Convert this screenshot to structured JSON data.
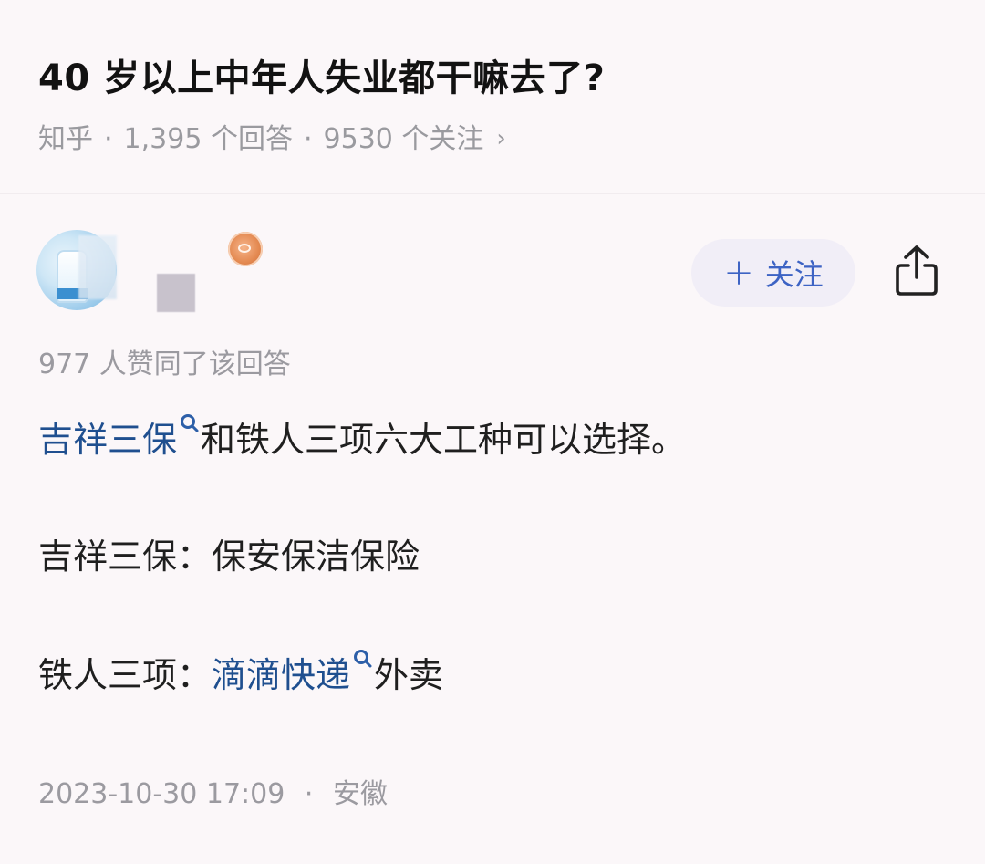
{
  "question": {
    "title": "40 岁以上中年人失业都干嘛去了?",
    "source": "知乎",
    "answers_count": "1,395 个回答",
    "followers_count": "9530 个关注",
    "separator": "·",
    "chevron": "›"
  },
  "author": {
    "follow_label": "关注",
    "follow_plus": "+",
    "avatar_icon": "avatar-image",
    "badge_icon": "medal-badge-icon",
    "share_icon": "share-icon"
  },
  "answer": {
    "vote_text": "977 人赞同了该回答",
    "p1_link": "吉祥三保",
    "p1_rest": "和铁人三项六大工种可以选择。",
    "p2": "吉祥三保：保安保洁保险",
    "p3_prefix": "铁人三项：",
    "p3_link": "滴滴快递",
    "p3_rest": "外卖"
  },
  "footer": {
    "timestamp": "2023-10-30 17:09",
    "separator": "·",
    "location": "安徽"
  },
  "colors": {
    "background": "#fbf7f9",
    "link": "#1f4f8f",
    "meta_gray": "#9b9aa0",
    "follow_blue": "#3d63c4"
  }
}
